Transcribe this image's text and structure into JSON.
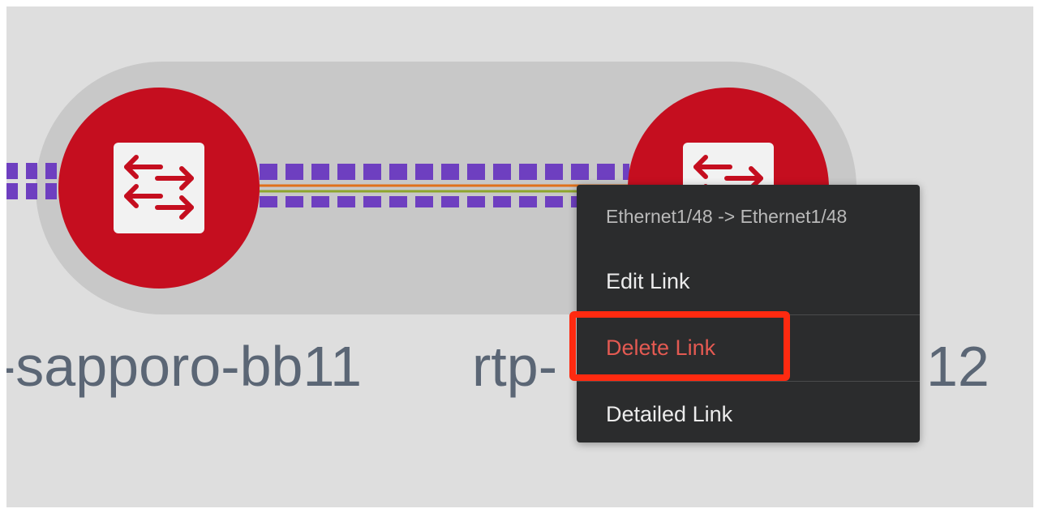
{
  "nodes": {
    "left": {
      "label": "-sapporo-bb11",
      "icon": "switch-arrows-icon",
      "color": "#c50e1f"
    },
    "right": {
      "label_visible_start": "rtp-",
      "label_visible_end": "12",
      "icon": "switch-arrows-icon",
      "color": "#c50e1f"
    }
  },
  "link": {
    "colors": {
      "dashes": "#6e3fc0",
      "line_top": "#e0701a",
      "line_bottom": "#8ea52d"
    }
  },
  "context_menu": {
    "header": "Ethernet1/48 -> Ethernet1/48",
    "items": [
      {
        "label": "Edit Link"
      },
      {
        "label": "Delete Link",
        "highlighted": true,
        "color": "#e45a52"
      },
      {
        "label": "Detailed Link"
      }
    ]
  },
  "highlight": {
    "target": "Delete Link",
    "color": "#ff2a10"
  }
}
